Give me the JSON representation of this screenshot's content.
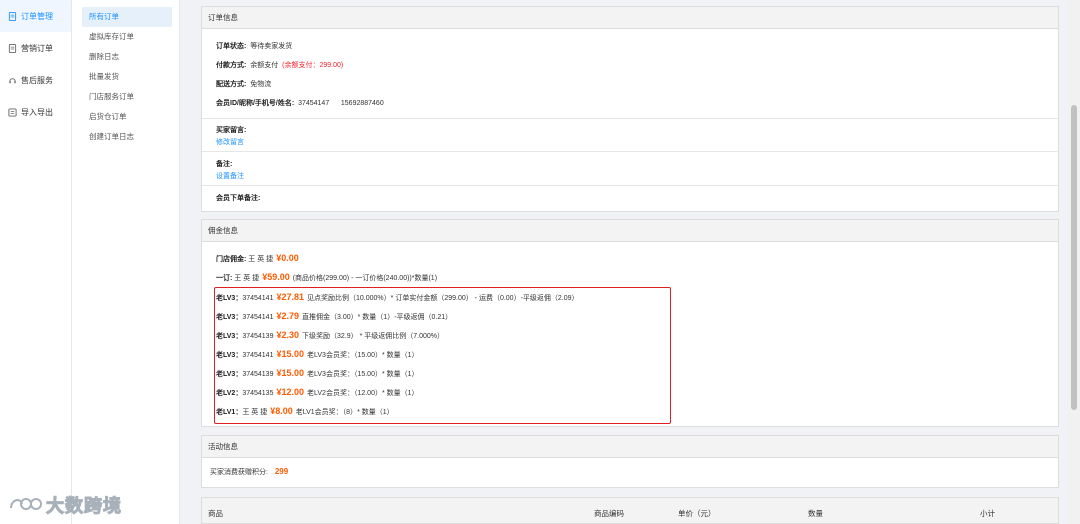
{
  "sidebar": {
    "items": [
      {
        "label": "订单管理",
        "icon": "document-icon"
      },
      {
        "label": "营销订单",
        "icon": "doc-list-icon"
      },
      {
        "label": "售后服务",
        "icon": "service-icon"
      },
      {
        "label": "导入导出",
        "icon": "import-export-icon"
      }
    ]
  },
  "subnav": {
    "items": [
      "所有订单",
      "虚拟库存订单",
      "删除日志",
      "批量发货",
      "门店服务订单",
      "启货仓订单",
      "创建订单日志"
    ]
  },
  "order_info": {
    "title": "订单信息",
    "status_label": "订单状态:",
    "status_value": "等待卖家发货",
    "pay_label": "付款方式:",
    "pay_value": "余额支付",
    "pay_note": "(余额支付：299.00)",
    "ship_label": "配送方式:",
    "ship_value": "免物流",
    "member_label": "会员ID/昵称/手机号/姓名:",
    "member_id": "37454147",
    "member_phone": "15692887460",
    "buyer_msg_label": "买家留言:",
    "buyer_msg_link": "修改留言",
    "remark_label": "备注:",
    "remark_link": "设置备注",
    "member_remark_label": "会员下单备注:"
  },
  "commission": {
    "title": "佣金信息",
    "store_label": "门店佣金:",
    "store_name": "王 英 捷",
    "store_amount": "¥0.00",
    "level1_label": "一订:",
    "level1_name": "王 英 捷",
    "level1_amount": "¥59.00",
    "level1_desc": "(商品价格(299.00) - 一订价格(240.00))*数量(1)",
    "rows": [
      {
        "label": "老LV3：",
        "id": "37454141",
        "amount": "¥27.81",
        "desc": "见点奖励比例（10.000%）* 订单实付金额（299.00） - 运费（0.00）-平级返佣（2.09）"
      },
      {
        "label": "老LV3：",
        "id": "37454141",
        "amount": "¥2.79",
        "desc": "直推佣金（3.00）* 数量（1）-平级返佣（0.21）"
      },
      {
        "label": "老LV3：",
        "id": "37454139",
        "amount": "¥2.30",
        "desc": "下级奖励（32.9） * 平级返佣比例（7.000%）"
      },
      {
        "label": "老LV3：",
        "id": "37454141",
        "amount": "¥15.00",
        "desc": "老LV3会员奖：（15.00）* 数量（1）"
      },
      {
        "label": "老LV3：",
        "id": "37454139",
        "amount": "¥15.00",
        "desc": "老LV3会员奖：（15.00）* 数量（1）"
      },
      {
        "label": "老LV2：",
        "id": "37454135",
        "amount": "¥12.00",
        "desc": "老LV2会员奖：（12.00）* 数量（1）"
      },
      {
        "label": "老LV1：",
        "id": "王 英 捷",
        "amount": "¥8.00",
        "desc": "老LV1会员奖：（8）* 数量（1）"
      }
    ]
  },
  "activity": {
    "title": "活动信息",
    "points_label": "买家消费获赠积分:",
    "points_value": "299"
  },
  "table": {
    "headers": [
      "商品",
      "商品编码",
      "单价（元）",
      "数量",
      "小计"
    ]
  },
  "watermark": {
    "text": "大数跨境"
  },
  "colors": {
    "accent": "#1890ff",
    "money": "#ff5a00",
    "highlight": "#e02020"
  }
}
